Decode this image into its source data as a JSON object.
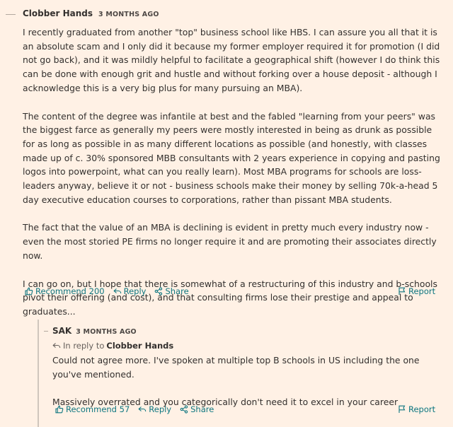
{
  "comment": {
    "author": "Clobber Hands",
    "timestamp": "3 MONTHS AGO",
    "paragraphs": [
      "I recently graduated from another \"top\" business school like HBS. I can assure you all that it is an absolute scam and I only did it because my former employer required it for promotion (I did not go back), and it was mildly helpful to facilitate a geographical shift (however I do think this can be done with enough grit and hustle and without forking over a house deposit - although I acknowledge this is a very big plus for many pursuing an MBA).",
      "The content of the degree was infantile at best and the fabled \"learning from your peers\" was the biggest farce as generally my peers were mostly interested in being as drunk as possible for as long as possible in as many different locations as possible (and honestly, with classes made up of c. 30% sponsored MBB consultants with 2 years experience in copying and pasting logos into powerpoint, what can you really learn). Most MBA programs for schools are loss-leaders anyway, believe it or not - business schools make their money by selling 70k-a-head 5 day executive education courses to corporations, rather than pissant MBA students.",
      "The fact that the value of an MBA is declining is evident in pretty much every industry now - even the most storied PE firms no longer require it and are promoting their associates directly now.",
      "I can go on, but I hope that there is somewhat of a restructuring of this industry and b-schools pivot their offering (and cost), and that consulting firms lose their prestige and appeal to graduates..."
    ],
    "recommend_label": "Recommend 200",
    "reply_label": "Reply",
    "share_label": "Share",
    "report_label": "Report"
  },
  "reply": {
    "author": "SAK",
    "timestamp": "3 MONTHS AGO",
    "in_reply_prefix": "In reply to",
    "in_reply_to": "Clobber Hands",
    "paragraphs": [
      "Could not agree more. I've spoken at multiple top B schools in US including the one you've mentioned.",
      "Massively overrated and you categorically don't need it to excel in your career"
    ],
    "recommend_label": "Recommend 57",
    "reply_label": "Reply",
    "share_label": "Share",
    "report_label": "Report"
  },
  "colors": {
    "background": "#fff1e5",
    "link": "#0d7680",
    "text": "#33302e"
  },
  "icons": [
    "thumbs-up-icon",
    "reply-arrow-icon",
    "share-icon",
    "flag-icon",
    "reply-arrow-icon"
  ]
}
